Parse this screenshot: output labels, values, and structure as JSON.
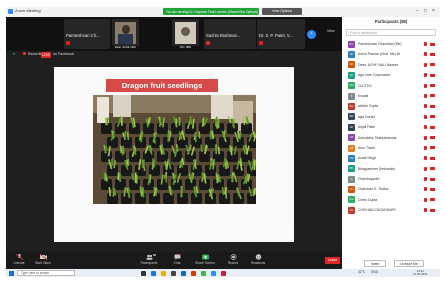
{
  "window": {
    "title": "Zoom Meeting",
    "banner": "You are viewing Dr. Ghyansh Paul's screen (Share/View Options)",
    "banner_button": "View Options"
  },
  "video_strip": {
    "tiles": [
      {
        "name": "Parmeshvari  Ch..."
      },
      {
        "name": "",
        "caption": "Dean, ACHF, NAU"
      },
      {
        "name": "",
        "caption": "CIO, NBU"
      },
      {
        "name": "Sachin  Brahman..."
      },
      {
        "name": "Dr. Z. P. Patel, V..."
      }
    ],
    "view_label": "View"
  },
  "recording_bar": {
    "recording_label": "Recording",
    "live_badge": "LIVE",
    "live_on": "on Facebook"
  },
  "slide": {
    "title": "Dragon fruit seedlings"
  },
  "toolbar": {
    "items": [
      {
        "label": "Unmute",
        "icon": "microphone-muted-icon"
      },
      {
        "label": "Start Video",
        "icon": "video-camera-icon"
      },
      {
        "label": "Participants",
        "icon": "participants-icon",
        "badge": "88"
      },
      {
        "label": "Chat",
        "icon": "chat-icon"
      },
      {
        "label": "Share Screen",
        "icon": "share-screen-icon"
      },
      {
        "label": "Record",
        "icon": "record-icon"
      },
      {
        "label": "Reactions",
        "icon": "reactions-icon"
      }
    ],
    "end_label": "Leave"
  },
  "participants": {
    "header": "Participants (88)",
    "search_placeholder": "Find a participant",
    "list": [
      {
        "name": "Parmeshvari Chaudhari (Me)",
        "initials": "PC",
        "color": "#8e44ad"
      },
      {
        "name": "Ankur Parmar (Host, Me) 4k",
        "initials": "AP",
        "color": "#2980b9"
      },
      {
        "name": "Dean, ACHF, NAU Navsari",
        "initials": "DN",
        "color": "#d35400"
      },
      {
        "name": "Agri-care Corporation",
        "initials": "AC",
        "color": "#16a085"
      },
      {
        "name": "OUJTEU",
        "initials": "OU",
        "color": "#27ae60"
      },
      {
        "name": "tirupati",
        "initials": "T",
        "color": "#7f8c8d"
      },
      {
        "name": "abhish Gupta",
        "initials": "AG",
        "color": "#c0392b"
      },
      {
        "name": "ajay Dorani",
        "initials": "AD",
        "color": "#34495e"
      },
      {
        "name": "Anjali Patel",
        "initials": "AP",
        "color": "#2c3e50"
      },
      {
        "name": "Aniruddha Thakkahanwar",
        "initials": "AT",
        "color": "#8e44ad"
      },
      {
        "name": "Arun Tiwari",
        "initials": "AT",
        "color": "#e67e22"
      },
      {
        "name": "Avadi Singh",
        "initials": "AS",
        "color": "#2980b9"
      },
      {
        "name": "Bhagyashree Deshmukh",
        "initials": "BD",
        "color": "#16a085"
      },
      {
        "name": "Chandrapprith",
        "initials": "C",
        "color": "#7f8c8d"
      },
      {
        "name": "Chandran H. Thakur",
        "initials": "CH",
        "color": "#d35400"
      },
      {
        "name": "Chetu Gupta",
        "initials": "CG",
        "color": "#27ae60"
      },
      {
        "name": "CHICHAN CHOUDHARY",
        "initials": "CC",
        "color": "#c0392b"
      }
    ],
    "footer": {
      "invite": "Invite",
      "mute_all": "Unmute Me"
    }
  },
  "taskbar": {
    "search_placeholder": "Type here to search",
    "weather": "32°C",
    "lang": "ENG",
    "time": "13:44",
    "date": "21-05-2022"
  }
}
